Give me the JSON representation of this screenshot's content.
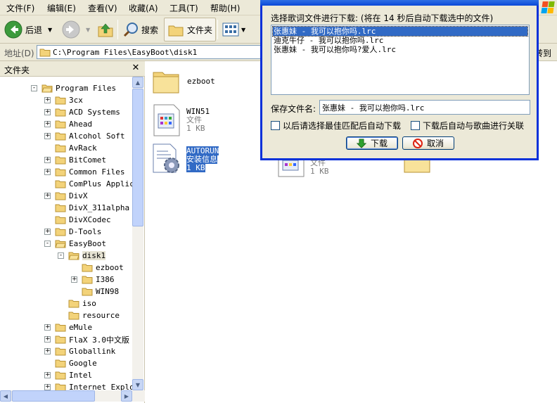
{
  "menu": {
    "items": [
      "文件(F)",
      "编辑(E)",
      "查看(V)",
      "收藏(A)",
      "工具(T)",
      "帮助(H)"
    ]
  },
  "toolbar": {
    "back_label": "后退",
    "search_label": "搜索",
    "folders_label": "文件夹"
  },
  "address": {
    "label": "地址(D)",
    "path": "C:\\Program Files\\EasyBoot\\disk1",
    "go_label": "转到"
  },
  "folder_pane": {
    "title": "文件夹",
    "items": [
      {
        "label": "Program Files",
        "depth": 0,
        "expander": "-"
      },
      {
        "label": "3cx",
        "depth": 1,
        "expander": "+"
      },
      {
        "label": "ACD Systems",
        "depth": 1,
        "expander": "+"
      },
      {
        "label": "Ahead",
        "depth": 1,
        "expander": "+"
      },
      {
        "label": "Alcohol Soft",
        "depth": 1,
        "expander": "+"
      },
      {
        "label": "AvRack",
        "depth": 1,
        "expander": ""
      },
      {
        "label": "BitComet",
        "depth": 1,
        "expander": "+"
      },
      {
        "label": "Common Files",
        "depth": 1,
        "expander": "+"
      },
      {
        "label": "ComPlus Applic",
        "depth": 1,
        "expander": ""
      },
      {
        "label": "DivX",
        "depth": 1,
        "expander": "+"
      },
      {
        "label": "DivX_311alpha",
        "depth": 1,
        "expander": ""
      },
      {
        "label": "DivXCodec",
        "depth": 1,
        "expander": ""
      },
      {
        "label": "D-Tools",
        "depth": 1,
        "expander": "+"
      },
      {
        "label": "EasyBoot",
        "depth": 1,
        "expander": "-"
      },
      {
        "label": "disk1",
        "depth": 2,
        "expander": "-",
        "selected": true
      },
      {
        "label": "ezboot",
        "depth": 3,
        "expander": ""
      },
      {
        "label": "I386",
        "depth": 3,
        "expander": "+"
      },
      {
        "label": "WIN98",
        "depth": 3,
        "expander": ""
      },
      {
        "label": "iso",
        "depth": 2,
        "expander": ""
      },
      {
        "label": "resource",
        "depth": 2,
        "expander": ""
      },
      {
        "label": "eMule",
        "depth": 1,
        "expander": "+"
      },
      {
        "label": "FlaX 3.0中文版",
        "depth": 1,
        "expander": "+"
      },
      {
        "label": "Globallink",
        "depth": 1,
        "expander": "+"
      },
      {
        "label": "Google",
        "depth": 1,
        "expander": ""
      },
      {
        "label": "Intel",
        "depth": 1,
        "expander": "+"
      },
      {
        "label": "Internet Explor",
        "depth": 1,
        "expander": "+"
      }
    ]
  },
  "files": {
    "ezboot": {
      "name": "ezboot"
    },
    "win51": {
      "name": "WIN51",
      "type": "文件",
      "size": "1 KB"
    },
    "autorun": {
      "name": "AUTORUN",
      "type": "安装信息",
      "size": "1 KB"
    },
    "hidden_item": {
      "type": "文件",
      "size": "1 KB"
    }
  },
  "dialog": {
    "prompt": "选择歌词文件进行下载: (将在 14 秒后自动下载选中的文件)",
    "lyrics": [
      "张惠妹 - 我可以抱你吗.lrc",
      "迪克牛仔 - 我可以抱你吗.lrc",
      "张惠妹 - 我可以抱你吗?爱人.lrc"
    ],
    "save_label": "保存文件名:",
    "save_value": "张惠妹 - 我可以抱你吗.lrc",
    "check_auto_download": "以后请选择最佳匹配后自动下载",
    "check_associate": "下载后自动与歌曲进行关联",
    "download_label": "下载",
    "cancel_label": "取消"
  },
  "colors": {
    "selection": "#316ac5",
    "dialog_border": "#0831d9",
    "chrome": "#ece9d8",
    "folder": "#f3d37a"
  }
}
